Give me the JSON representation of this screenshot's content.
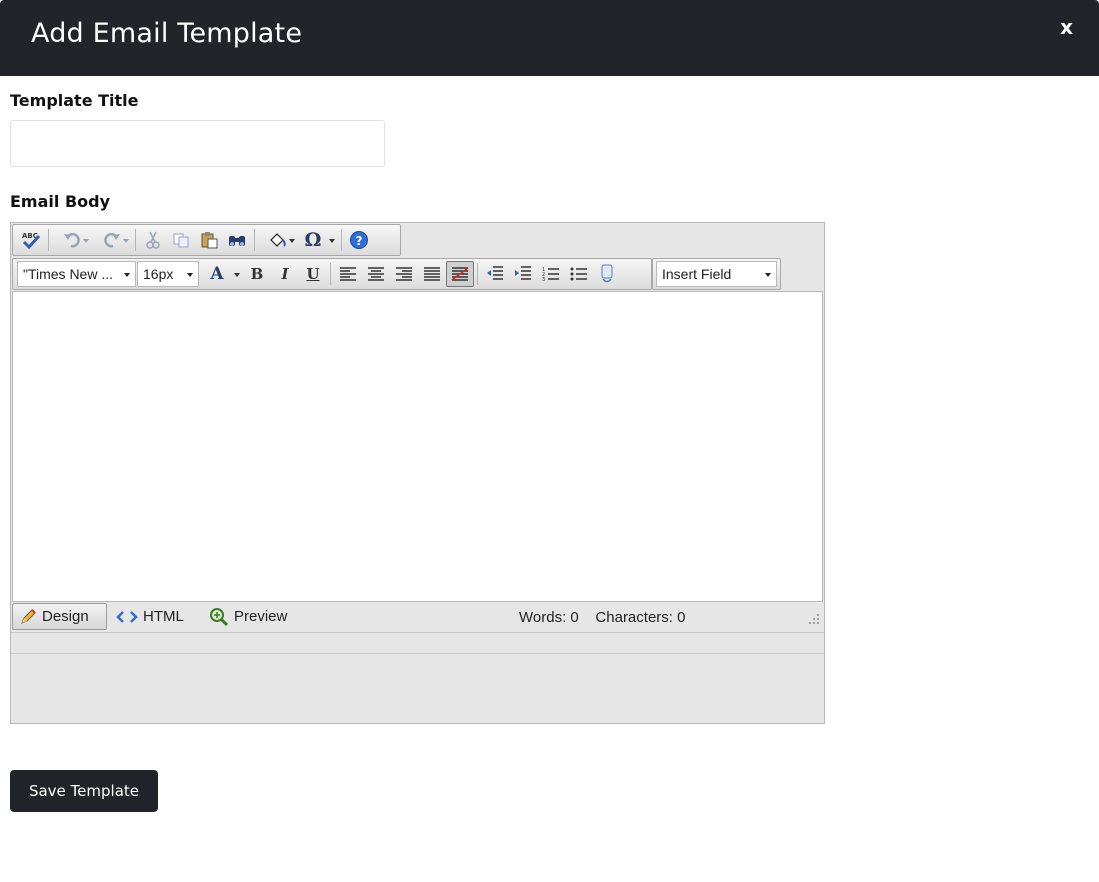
{
  "modal": {
    "title": "Add Email Template",
    "close_label": "x"
  },
  "form": {
    "title_label": "Template Title",
    "title_value": "",
    "body_label": "Email Body"
  },
  "editor": {
    "toolbar_row1": [
      {
        "name": "spellcheck-icon",
        "glyph": "ABC✓"
      },
      {
        "name": "undo-icon",
        "glyph": "↶"
      },
      {
        "name": "redo-icon",
        "glyph": "↷"
      },
      {
        "name": "cut-icon",
        "glyph": "✂"
      },
      {
        "name": "copy-icon",
        "glyph": "⧉"
      },
      {
        "name": "paste-icon",
        "glyph": "📋"
      },
      {
        "name": "find-replace-icon",
        "glyph": "🔍"
      },
      {
        "name": "background-color-icon",
        "glyph": "◈"
      },
      {
        "name": "special-character-icon",
        "glyph": "Ω"
      },
      {
        "name": "help-icon",
        "glyph": "?"
      }
    ],
    "font_family": "\"Times New ...",
    "font_size": "16px",
    "font_color_glyph": "A",
    "bold_glyph": "B",
    "italic_glyph": "I",
    "underline_glyph": "U",
    "insert_field": "Insert Field",
    "modes": {
      "design": "Design",
      "html": "HTML",
      "preview": "Preview"
    },
    "words_label": "Words: 0",
    "characters_label": "Characters: 0"
  },
  "actions": {
    "save_label": "Save Template"
  },
  "colors": {
    "header_bg": "#212529",
    "button_bg": "#212529",
    "icon_blue": "#2f5fb3"
  }
}
